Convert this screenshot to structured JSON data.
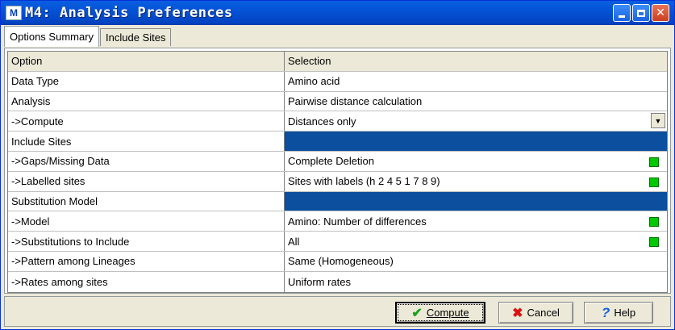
{
  "window": {
    "title": "M4: Analysis Preferences",
    "logo_letter": "M"
  },
  "tabs": [
    {
      "label": "Options Summary",
      "active": true
    },
    {
      "label": "Include Sites",
      "active": false
    }
  ],
  "grid": {
    "headers": [
      "Option",
      "Selection"
    ],
    "rows": [
      {
        "option": "Data Type",
        "selection": "Amino acid"
      },
      {
        "option": "Analysis",
        "selection": "Pairwise distance calculation"
      },
      {
        "option": "->Compute",
        "selection": "Distances only"
      },
      {
        "option": "Include Sites",
        "selection": ""
      },
      {
        "option": "->Gaps/Missing Data",
        "selection": "Complete Deletion"
      },
      {
        "option": "->Labelled sites",
        "selection": "Sites with labels (h 2 4 5 1 7 8 9)"
      },
      {
        "option": "Substitution Model",
        "selection": ""
      },
      {
        "option": "->Model",
        "selection": "Amino: Number of differences"
      },
      {
        "option": "->Substitutions to Include",
        "selection": "All"
      },
      {
        "option": "->Pattern among Lineages",
        "selection": "Same (Homogeneous)"
      },
      {
        "option": "->Rates among sites",
        "selection": "Uniform rates"
      }
    ]
  },
  "buttons": {
    "compute": "Compute",
    "cancel": "Cancel",
    "help": "Help"
  },
  "colors": {
    "section_highlight": "#0b4f9e",
    "indicator": "#00c800",
    "titlebar": "#0453d6"
  }
}
